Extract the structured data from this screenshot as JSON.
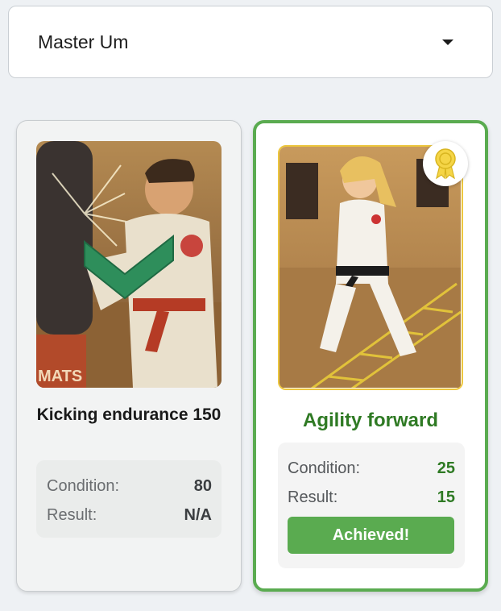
{
  "selector": {
    "value": "Master Um",
    "icon": "caret-down-icon"
  },
  "cards": [
    {
      "title": "Kicking endurance 150",
      "condition_label": "Condition:",
      "condition_value": "80",
      "result_label": "Result:",
      "result_value": "N/A",
      "status": "in-progress",
      "image": "kicking-heavy-bag-illustration",
      "overlay_icon": "green-chevron-down-icon"
    },
    {
      "title": "Agility forward",
      "condition_label": "Condition:",
      "condition_value": "25",
      "result_label": "Result:",
      "result_value": "15",
      "status": "achieved",
      "badge_icon": "award-ribbon-icon",
      "image": "agility-ladder-illustration",
      "button_label": "Achieved!"
    }
  ],
  "colors": {
    "accent_green": "#5aab50",
    "title_green": "#2f7a24",
    "badge_gold": "#ecc63e",
    "background": "#eef1f4"
  }
}
